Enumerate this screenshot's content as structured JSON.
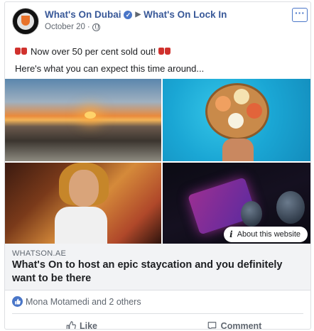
{
  "post": {
    "author": "What's On Dubai",
    "target_page": "What's On Lock In",
    "date": "October 20",
    "line1": "Now over 50 per cent sold out!",
    "line2": "Here's what you can expect this time around..."
  },
  "link_preview": {
    "domain": "WHATSON.AE",
    "title": "What's On to host an epic staycation and you definitely want to be there",
    "about_label": "About this website"
  },
  "reactions": {
    "summary": "Mona Motamedi and 2 others"
  },
  "actions": {
    "like": "Like",
    "comment": "Comment"
  },
  "icons": [
    "verified-icon",
    "caret-right-icon",
    "globe-icon",
    "more-icon",
    "info-icon",
    "like-reaction-icon",
    "thumbs-up-icon",
    "comment-icon"
  ],
  "colors": {
    "link_blue": "#385898",
    "accent": "#4a76c8",
    "muted": "#606770"
  }
}
